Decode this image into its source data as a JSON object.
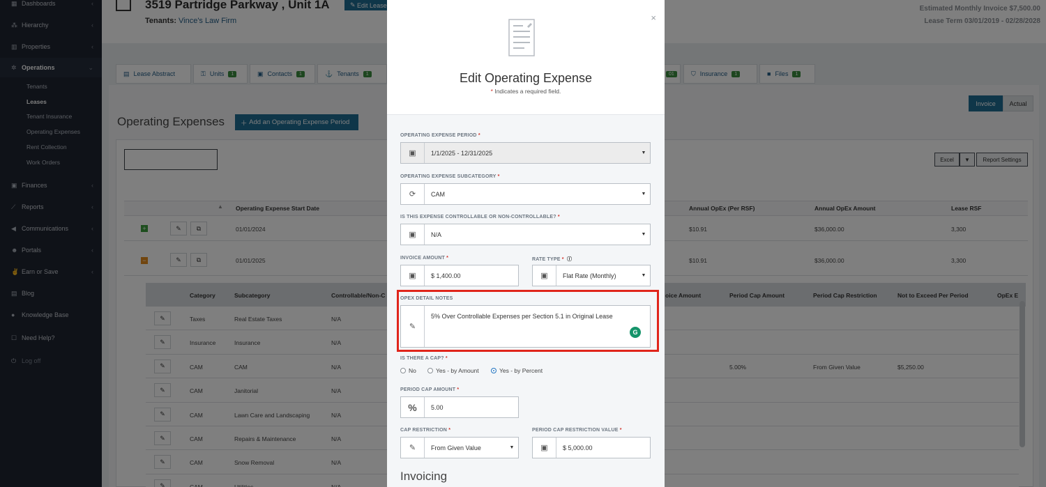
{
  "sidebar": {
    "items": [
      {
        "label": "Dashboards",
        "icon": "grid-icon"
      },
      {
        "label": "Hierarchy",
        "icon": "hierarchy-icon"
      },
      {
        "label": "Properties",
        "icon": "bar-chart-icon"
      },
      {
        "label": "Operations",
        "icon": "gear-icon"
      },
      {
        "label": "Finances",
        "icon": "money-icon"
      },
      {
        "label": "Reports",
        "icon": "line-chart-icon"
      },
      {
        "label": "Communications",
        "icon": "megaphone-icon"
      },
      {
        "label": "Portals",
        "icon": "users-icon"
      },
      {
        "label": "Earn or Save",
        "icon": "thumbs-up-icon"
      },
      {
        "label": "Blog",
        "icon": "blog-icon"
      },
      {
        "label": "Knowledge Base",
        "icon": "info-icon"
      },
      {
        "label": "Need Help?",
        "icon": "chat-icon"
      },
      {
        "label": "Log off",
        "icon": "power-icon"
      }
    ],
    "operations_sub": [
      "Tenants",
      "Leases",
      "Tenant Insurance",
      "Operating Expenses",
      "Rent Collection",
      "Work Orders"
    ]
  },
  "header": {
    "title": "3519 Partridge Parkway , Unit 1A",
    "edit_label": "Edit Lease",
    "tenants_label": "Tenants:",
    "tenant_name": "Vince's Law Firm",
    "estimated_invoice": "Estimated Monthly Invoice $7,500.00",
    "lease_term": "Lease Term 03/01/2019 - 02/28/2028"
  },
  "tabs": [
    {
      "label": "Lease Abstract",
      "badge": ""
    },
    {
      "label": "Units",
      "badge": "1"
    },
    {
      "label": "Contacts",
      "badge": "1"
    },
    {
      "label": "Tenants",
      "badge": "1"
    },
    {
      "label": "",
      "badge": "01"
    },
    {
      "label": "Insurance",
      "badge": "1"
    },
    {
      "label": "Files",
      "badge": "1"
    }
  ],
  "opex": {
    "heading": "Operating Expenses",
    "add_button": "Add an Operating Expense Period",
    "toggle": [
      "Invoice",
      "Actual"
    ],
    "excel": "Excel",
    "report_settings": "Report Settings",
    "columns": [
      "Operating Expense Start Date",
      "Annual OpEx (Per RSF)",
      "Annual OpEx Amount",
      "Lease RSF"
    ],
    "periods": [
      {
        "start": "01/01/2024",
        "per_rsf": "$10.91",
        "amount": "$36,000.00",
        "rsf": "3,300"
      },
      {
        "start": "01/01/2025",
        "per_rsf": "$10.91",
        "amount": "$36,000.00",
        "rsf": "3,300"
      }
    ],
    "detail_columns": [
      "Category",
      "Subcategory",
      "Controllable/Non-C",
      "oice Amount",
      "Period Cap Amount",
      "Period Cap Restriction",
      "Not to Exceed Per Period",
      "OpEx E"
    ],
    "details": [
      {
        "category": "Taxes",
        "subcategory": "Real Estate Taxes",
        "ctrl": "N/A",
        "cap": "",
        "restriction": "",
        "nte": ""
      },
      {
        "category": "Insurance",
        "subcategory": "Insurance",
        "ctrl": "N/A",
        "cap": "",
        "restriction": "",
        "nte": ""
      },
      {
        "category": "CAM",
        "subcategory": "CAM",
        "ctrl": "N/A",
        "cap": "5.00%",
        "restriction": "From Given Value",
        "nte": "$5,250.00"
      },
      {
        "category": "CAM",
        "subcategory": "Janitorial",
        "ctrl": "N/A",
        "cap": "",
        "restriction": "",
        "nte": ""
      },
      {
        "category": "CAM",
        "subcategory": "Lawn Care and Landscaping",
        "ctrl": "N/A",
        "cap": "",
        "restriction": "",
        "nte": ""
      },
      {
        "category": "CAM",
        "subcategory": "Repairs & Maintenance",
        "ctrl": "N/A",
        "cap": "",
        "restriction": "",
        "nte": ""
      },
      {
        "category": "CAM",
        "subcategory": "Snow Removal",
        "ctrl": "N/A",
        "cap": "",
        "restriction": "",
        "nte": ""
      },
      {
        "category": "CAM",
        "subcategory": "Utilities",
        "ctrl": "N/A",
        "cap": "",
        "restriction": "",
        "nte": ""
      }
    ]
  },
  "modal": {
    "title": "Edit Operating Expense",
    "required_note": "Indicates a required field.",
    "required_mark": "*",
    "close": "×",
    "period_label": "Operating Expense Period",
    "period_value": "1/1/2025 - 12/31/2025",
    "subcategory_label": "Operating Expense Subcategory",
    "subcategory_value": "CAM",
    "controllable_label": "Is this expense controllable or non-controllable?",
    "controllable_value": "N/A",
    "invoice_amount_label": "Invoice Amount",
    "invoice_amount_value": "$ 1,400.00",
    "rate_type_label": "Rate Type",
    "rate_type_value": "Flat Rate (Monthly)",
    "notes_label": "OpEx Detail Notes",
    "notes_value": "5% Over Controllable Expenses per Section 5.1 in Original Lease",
    "cap_question": "Is there a cap?",
    "cap_options": [
      "No",
      "Yes - by Amount",
      "Yes - by Percent"
    ],
    "cap_selected": "Yes - by Percent",
    "period_cap_label": "Period Cap Amount",
    "period_cap_value": "5.00",
    "cap_restriction_label": "Cap Restriction",
    "cap_restriction_value": "From Given Value",
    "cap_restriction_value_label": "Period Cap Restriction Value",
    "cap_restriction_value_value": "$ 5,000.00",
    "invoicing_heading": "Invoicing"
  },
  "colors": {
    "sidebar": "#1e2430",
    "accent": "#1f6d93",
    "badge": "#3a8d3e",
    "highlight": "#e0251b"
  }
}
